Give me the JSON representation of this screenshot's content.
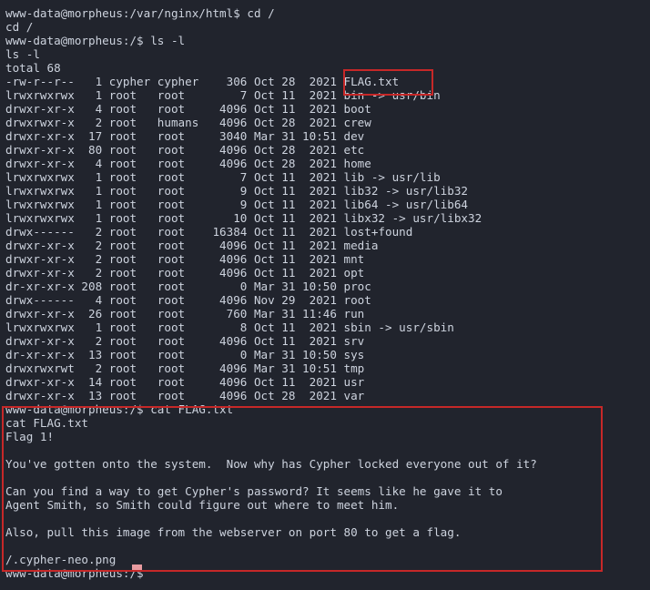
{
  "terminal": {
    "colors": {
      "background": "#21242d",
      "foreground": "#cdd3de",
      "annotation": "#c62828",
      "cursor": "#e89ba0"
    },
    "host": "morpheus",
    "user": "www-data",
    "lines": [
      "www-data@morpheus:/var/nginx/html$ cd /",
      "cd /",
      "www-data@morpheus:/$ ls -l",
      "ls -l",
      "total 68",
      "-rw-r--r--   1 cypher cypher    306 Oct 28  2021 FLAG.txt",
      "lrwxrwxrwx   1 root   root        7 Oct 11  2021 bin -> usr/bin",
      "drwxr-xr-x   4 root   root     4096 Oct 11  2021 boot",
      "drwxrwxr-x   2 root   humans   4096 Oct 28  2021 crew",
      "drwxr-xr-x  17 root   root     3040 Mar 31 10:51 dev",
      "drwxr-xr-x  80 root   root     4096 Oct 28  2021 etc",
      "drwxr-xr-x   4 root   root     4096 Oct 28  2021 home",
      "lrwxrwxrwx   1 root   root        7 Oct 11  2021 lib -> usr/lib",
      "lrwxrwxrwx   1 root   root        9 Oct 11  2021 lib32 -> usr/lib32",
      "lrwxrwxrwx   1 root   root        9 Oct 11  2021 lib64 -> usr/lib64",
      "lrwxrwxrwx   1 root   root       10 Oct 11  2021 libx32 -> usr/libx32",
      "drwx------   2 root   root    16384 Oct 11  2021 lost+found",
      "drwxr-xr-x   2 root   root     4096 Oct 11  2021 media",
      "drwxr-xr-x   2 root   root     4096 Oct 11  2021 mnt",
      "drwxr-xr-x   2 root   root     4096 Oct 11  2021 opt",
      "dr-xr-xr-x 208 root   root        0 Mar 31 10:50 proc",
      "drwx------   4 root   root     4096 Nov 29  2021 root",
      "drwxr-xr-x  26 root   root      760 Mar 31 11:46 run",
      "lrwxrwxrwx   1 root   root        8 Oct 11  2021 sbin -> usr/sbin",
      "drwxr-xr-x   2 root   root     4096 Oct 11  2021 srv",
      "dr-xr-xr-x  13 root   root        0 Mar 31 10:50 sys",
      "drwxrwxrwt   2 root   root     4096 Mar 31 10:51 tmp",
      "drwxr-xr-x  14 root   root     4096 Oct 11  2021 usr",
      "drwxr-xr-x  13 root   root     4096 Oct 28  2021 var",
      "www-data@morpheus:/$ cat FLAG.txt",
      "cat FLAG.txt",
      "Flag 1!",
      "",
      "You've gotten onto the system.  Now why has Cypher locked everyone out of it?",
      "",
      "Can you find a way to get Cypher's password? It seems like he gave it to",
      "Agent Smith, so Smith could figure out where to meet him.",
      "",
      "Also, pull this image from the webserver on port 80 to get a flag.",
      "",
      "/.cypher-neo.png",
      "www-data@morpheus:/$"
    ]
  },
  "annotations": [
    {
      "id": "flag-filename-highlight",
      "label": "FLAG.txt",
      "color": "#c62828"
    },
    {
      "id": "flag-content-highlight",
      "label": "cat FLAG.txt output",
      "color": "#c62828"
    }
  ]
}
